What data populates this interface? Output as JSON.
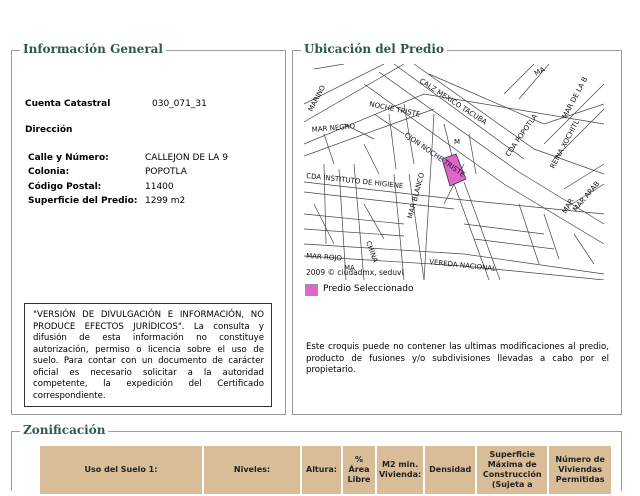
{
  "info": {
    "legend": "Información General",
    "cuenta_label": "Cuenta Catastral",
    "cuenta_value": "030_071_31",
    "direccion_label": "Dirección",
    "calle_label": "Calle y Número:",
    "calle_value": "CALLEJON DE LA 9",
    "colonia_label": "Colonia:",
    "colonia_value": "POPOTLA",
    "cp_label": "Código Postal:",
    "cp_value": "11400",
    "superficie_label": "Superficie del Predio:",
    "superficie_value": "1299 m2",
    "notice": "\"VERSIÓN DE DIVULGACIÓN E INFORMACIÓN, NO PRODUCE EFECTOS JURÍDICOS\". La consulta y difusión de esta información no constituye autorización, permiso o licencia sobre el uso de suelo. Para contar con un documento de carácter oficial es necesario solicitar a la autoridad competente, la expedición del Certificado correspondiente."
  },
  "ubicacion": {
    "legend": "Ubicación del Predio",
    "map_credit": "2009 © ciudadmx, seduvi",
    "predio_legend": "Predio Seleccionado",
    "predio_color": "#dd66cc",
    "note": "Este croquis puede no contener las ultimas modificaciones al predio, producto de fusiones y/o subdivisiones llevadas a cabo por el propietario.",
    "streets": {
      "marino": "MARINO",
      "noche_triste": "NOCHE TRISTE",
      "calz_mexico_tacuba": "CALZ MEXICO TACUBA",
      "mar_negro": "MAR NEGRO",
      "cjon_noche_triste": "CJON NOCHE TRISTE",
      "cda_popotla": "CDA POPOTLA",
      "reina_xochitl": "REINA XOCHITL",
      "mar_de_la_b": "MAR DE LA B",
      "cda_instituto_de_higiene": "CDA INSTITUTO DE HIGIENE",
      "mar_arab": "MAR ARAB",
      "mar": "MAR",
      "mar_rojo": "MAR ROJO",
      "china": "CHINA",
      "mar_blanco": "MAR BLANCO",
      "vereda_nacional": "VEREDA NACIONAL",
      "ma_top": "MA",
      "ma_bottom": "MA",
      "m": "M"
    }
  },
  "zonificacion": {
    "legend": "Zonificación",
    "headers": [
      "Uso del Suelo 1:",
      "Niveles:",
      "Altura:",
      "% Área Libre",
      "M2 min. Vivienda:",
      "Densidad",
      "Superficie Máxima de Construcción (Sujeta a",
      "Número de Viviendas Permitidas"
    ]
  }
}
